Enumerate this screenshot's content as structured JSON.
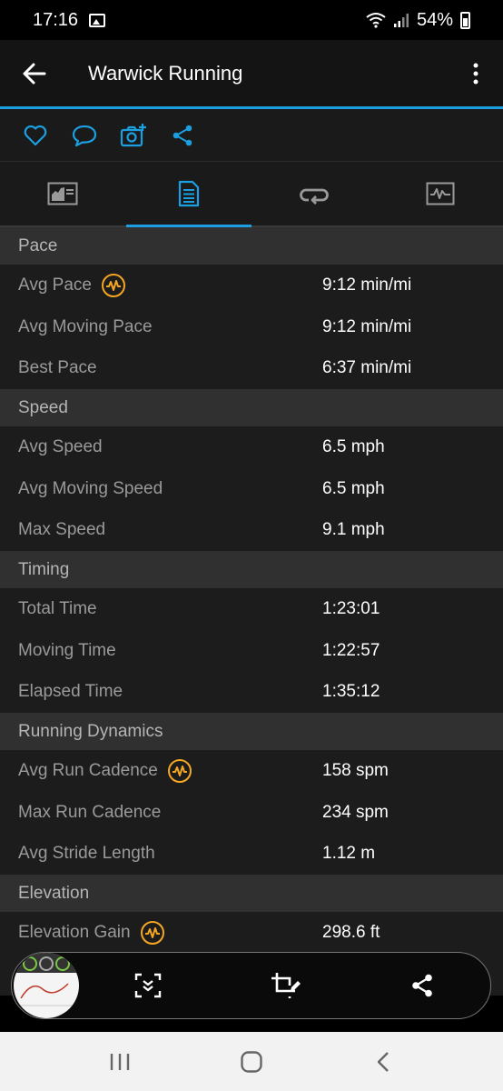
{
  "status_bar": {
    "time": "17:16",
    "battery": "54%"
  },
  "header": {
    "title": "Warwick Running"
  },
  "sections": [
    {
      "title": "Pace",
      "rows": [
        {
          "label": "Avg Pace",
          "value": "9:12 min/mi",
          "badge": true
        },
        {
          "label": "Avg Moving Pace",
          "value": "9:12 min/mi",
          "badge": false
        },
        {
          "label": "Best Pace",
          "value": "6:37 min/mi",
          "badge": false
        }
      ]
    },
    {
      "title": "Speed",
      "rows": [
        {
          "label": "Avg Speed",
          "value": "6.5 mph",
          "badge": false
        },
        {
          "label": "Avg Moving Speed",
          "value": "6.5 mph",
          "badge": false
        },
        {
          "label": "Max Speed",
          "value": "9.1 mph",
          "badge": false
        }
      ]
    },
    {
      "title": "Timing",
      "rows": [
        {
          "label": "Total Time",
          "value": "1:23:01",
          "badge": false
        },
        {
          "label": "Moving Time",
          "value": "1:22:57",
          "badge": false
        },
        {
          "label": "Elapsed Time",
          "value": "1:35:12",
          "badge": false
        }
      ]
    },
    {
      "title": "Running Dynamics",
      "rows": [
        {
          "label": "Avg Run Cadence",
          "value": "158 spm",
          "badge": true
        },
        {
          "label": "Max Run Cadence",
          "value": "234 spm",
          "badge": false
        },
        {
          "label": "Avg Stride Length",
          "value": "1.12 m",
          "badge": false
        }
      ]
    },
    {
      "title": "Elevation",
      "rows": [
        {
          "label": "Elevation Gain",
          "value": "298.6 ft",
          "badge": true
        }
      ]
    }
  ],
  "icons": {
    "back": "arrow-left-icon",
    "more": "more-vertical-icon",
    "like": "heart-icon",
    "comment": "comment-icon",
    "photo": "camera-add-icon",
    "share": "share-icon",
    "tabs": [
      "overview-chart-icon",
      "details-document-icon",
      "laps-loop-icon",
      "graphs-icon"
    ],
    "badge": "performance-badge-icon"
  },
  "colors": {
    "accent": "#1b9fe0",
    "badge": "#f5a623",
    "background": "#1c1c1c",
    "section_header": "#303030"
  }
}
